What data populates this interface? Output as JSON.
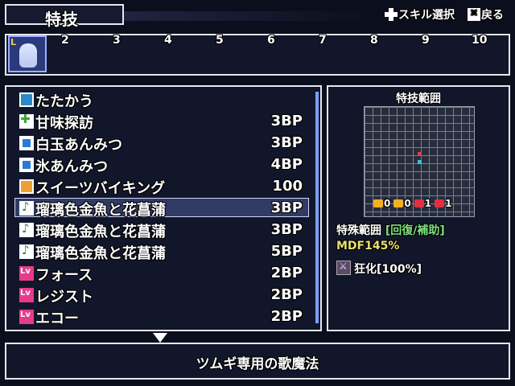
{
  "header": {
    "title": "特技",
    "hint_select": "スキル選択",
    "hint_back": "戻る",
    "dpad_icon": "dpad-icon",
    "x_button_icon": "x-button-icon"
  },
  "turn_bar": {
    "portrait_label": "L",
    "numbers": [
      "2",
      "3",
      "4",
      "5",
      "6",
      "7",
      "8",
      "9",
      "10"
    ]
  },
  "skills": [
    {
      "name": "たたかう",
      "cost": "",
      "icon": "sword-icon"
    },
    {
      "name": "甘味探訪",
      "cost": "3BP",
      "icon": "plus-icon"
    },
    {
      "name": "白玉あんみつ",
      "cost": "3BP",
      "icon": "blue-square-icon"
    },
    {
      "name": "氷あんみつ",
      "cost": "4BP",
      "icon": "blue-square-icon"
    },
    {
      "name": "スイーツバイキング",
      "cost": "100",
      "icon": "orange-pattern-icon"
    },
    {
      "name": "瑠璃色金魚と花菖蒲",
      "cost": "3BP",
      "icon": "music-note-icon"
    },
    {
      "name": "瑠璃色金魚と花菖蒲",
      "cost": "3BP",
      "icon": "music-note-icon"
    },
    {
      "name": "瑠璃色金魚と花菖蒲",
      "cost": "5BP",
      "icon": "music-note-icon"
    },
    {
      "name": "フォース",
      "cost": "2BP",
      "icon": "level-icon"
    },
    {
      "name": "レジスト",
      "cost": "2BP",
      "icon": "level-icon"
    },
    {
      "name": "エコー",
      "cost": "2BP",
      "icon": "level-icon"
    }
  ],
  "selected_index": 5,
  "range_panel": {
    "title": "特技範囲",
    "buffs": [
      "0",
      "0",
      "1",
      "1"
    ],
    "special_label": "特殊範囲",
    "special_bracket_open": "[",
    "special_type_a": "回復",
    "special_sep": "/",
    "special_type_b": "補助",
    "special_bracket_close": "]",
    "mdf": "MDF145%",
    "status_effect": "狂化[100%]"
  },
  "description": "ツムギ専用の歌魔法",
  "colors": {
    "accent": "#7aa0ff",
    "panel": "#12162a",
    "border": "#e6e6ee",
    "heal": "#7fe07f",
    "mdf": "#e8e070"
  }
}
